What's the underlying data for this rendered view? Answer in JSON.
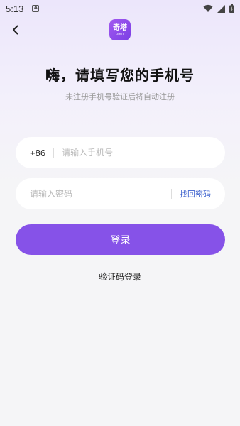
{
  "status_bar": {
    "time": "5:13",
    "notification_letter": "A"
  },
  "logo": {
    "main": "奇塔",
    "sub": "QIKIT"
  },
  "header": {
    "title": "嗨，请填写您的手机号",
    "subtitle": "未注册手机号验证后将自动注册"
  },
  "phone_field": {
    "country_code": "+86",
    "placeholder": "请输入手机号",
    "value": ""
  },
  "password_field": {
    "placeholder": "请输入密码",
    "value": "",
    "forgot_label": "找回密码"
  },
  "login_button": {
    "label": "登录"
  },
  "code_login": {
    "label": "验证码登录"
  },
  "colors": {
    "accent": "#8652e8",
    "link": "#3a5fcd"
  },
  "icons": [
    "back-arrow-icon",
    "wifi-icon",
    "signal-icon",
    "battery-icon"
  ]
}
